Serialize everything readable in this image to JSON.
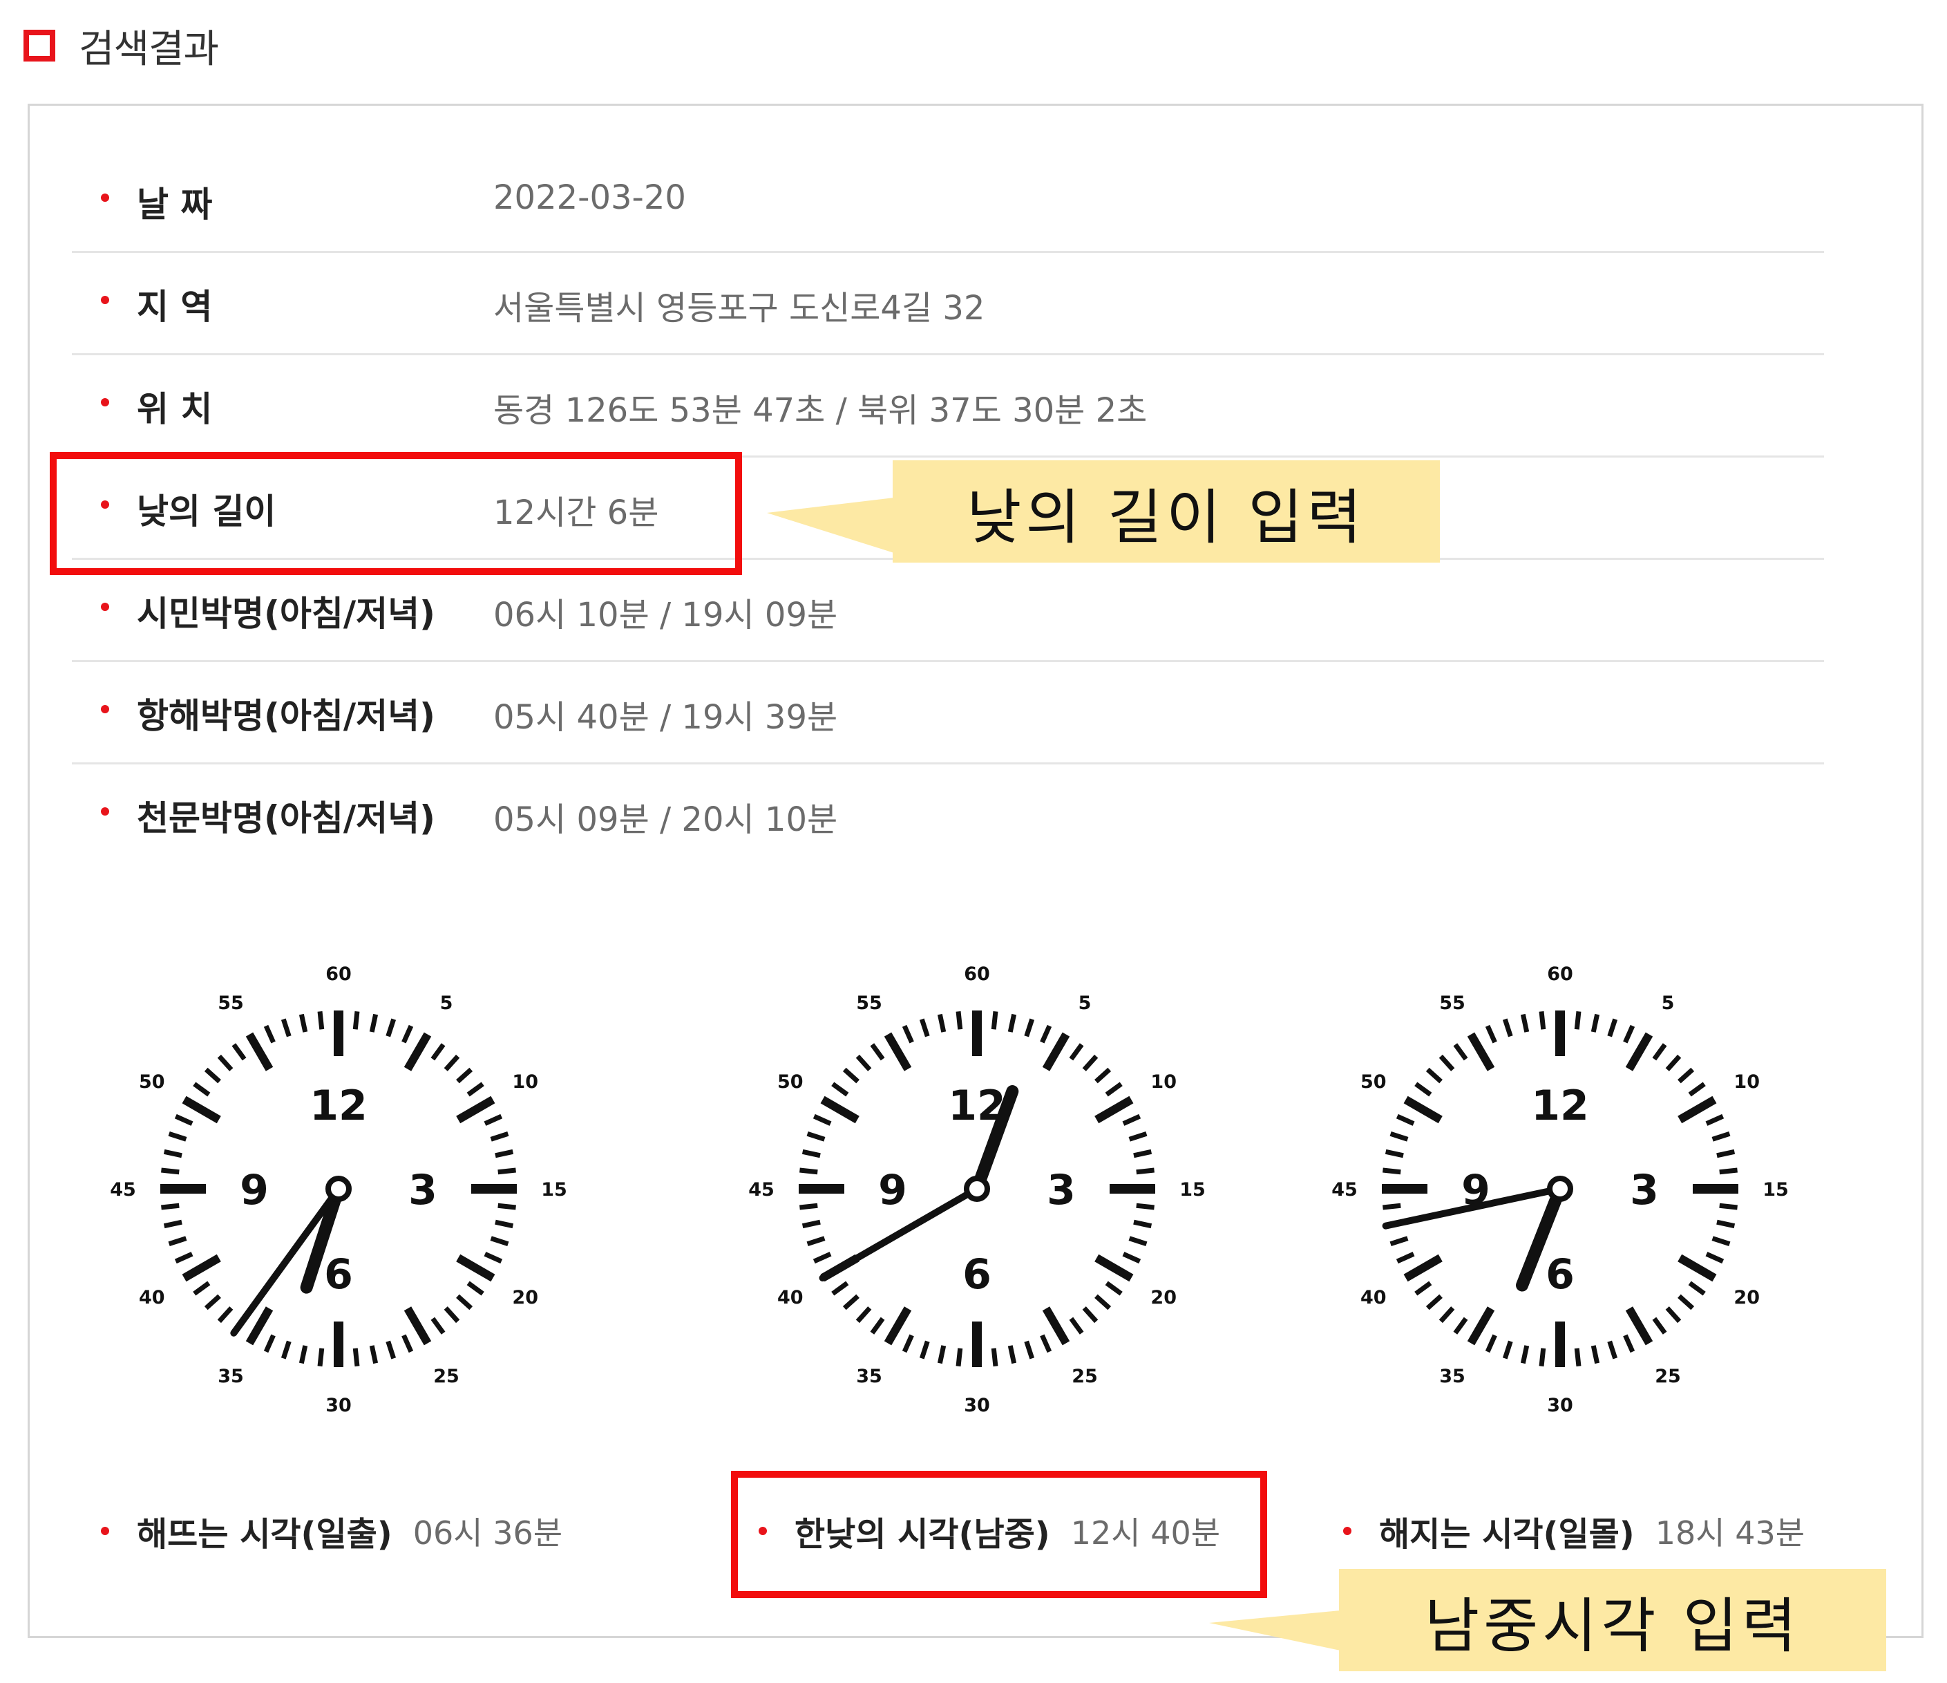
{
  "header": {
    "title": "검색결과"
  },
  "rows": [
    {
      "label": "날 짜",
      "value": "2022-03-20"
    },
    {
      "label": "지 역",
      "value": "서울특별시 영등포구 도신로4길 32"
    },
    {
      "label": "위 치",
      "value": "동경 126도 53분 47초 / 북위 37도 30분 2초"
    },
    {
      "label": "낮의 길이",
      "value": "12시간 6분"
    },
    {
      "label": "시민박명(아침/저녁)",
      "value": "06시 10분 / 19시 09분"
    },
    {
      "label": "항해박명(아침/저녁)",
      "value": "05시 40분 / 19시 39분"
    },
    {
      "label": "천문박명(아침/저녁)",
      "value": "05시 09분 / 20시 10분"
    }
  ],
  "clock_face": {
    "minute_labels": [
      "60",
      "5",
      "10",
      "15",
      "20",
      "25",
      "30",
      "35",
      "40",
      "45",
      "50",
      "55"
    ],
    "hour_labels": [
      "12",
      "3",
      "6",
      "9"
    ]
  },
  "clocks": [
    {
      "name": "sunrise",
      "hour": 6,
      "minute": 36
    },
    {
      "name": "transit",
      "hour": 12,
      "minute": 40
    },
    {
      "name": "sunset",
      "hour": 18,
      "minute": 43
    }
  ],
  "bottom": [
    {
      "label": "해뜨는 시각(일출)",
      "value": "06시 36분"
    },
    {
      "label": "한낮의 시각(남중)",
      "value": "12시 40분"
    },
    {
      "label": "해지는 시각(일몰)",
      "value": "18시 43분"
    }
  ],
  "callouts": {
    "daylength": "낮의 길이 입력",
    "transit": "남중시각 입력"
  },
  "colors": {
    "accent_red": "#e8141b",
    "highlight_red": "#f20d0d",
    "callout_bg": "#fde9a4"
  }
}
